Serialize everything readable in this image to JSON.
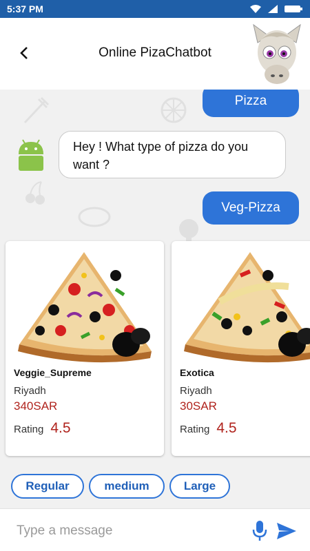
{
  "status_bar": {
    "time": "5:37 PM"
  },
  "header": {
    "title": "Online PizaChatbot"
  },
  "messages": {
    "user_1": "Pizza",
    "bot_1": "Hey ! What type of pizza do you want ?",
    "user_2": "Veg-Pizza"
  },
  "cards": [
    {
      "name": "Veggie_Supreme",
      "city": "Riyadh",
      "price": "340SAR",
      "rating_label": "Rating",
      "rating": "4.5"
    },
    {
      "name": "Exotica",
      "city": "Riyadh",
      "price": "30SAR",
      "rating_label": "Rating",
      "rating": "4.5"
    }
  ],
  "quick_replies": [
    "Regular",
    "medium",
    "Large"
  ],
  "composer": {
    "placeholder": "Type a message"
  },
  "colors": {
    "status_bar": "#1f5fa8",
    "user_bubble": "#2e74d8",
    "price": "#b0231d",
    "chip_border": "#2e74d8"
  },
  "icons": [
    "back-arrow-icon",
    "wifi-icon",
    "signal-icon",
    "battery-icon",
    "android-icon",
    "mic-icon",
    "send-icon"
  ]
}
